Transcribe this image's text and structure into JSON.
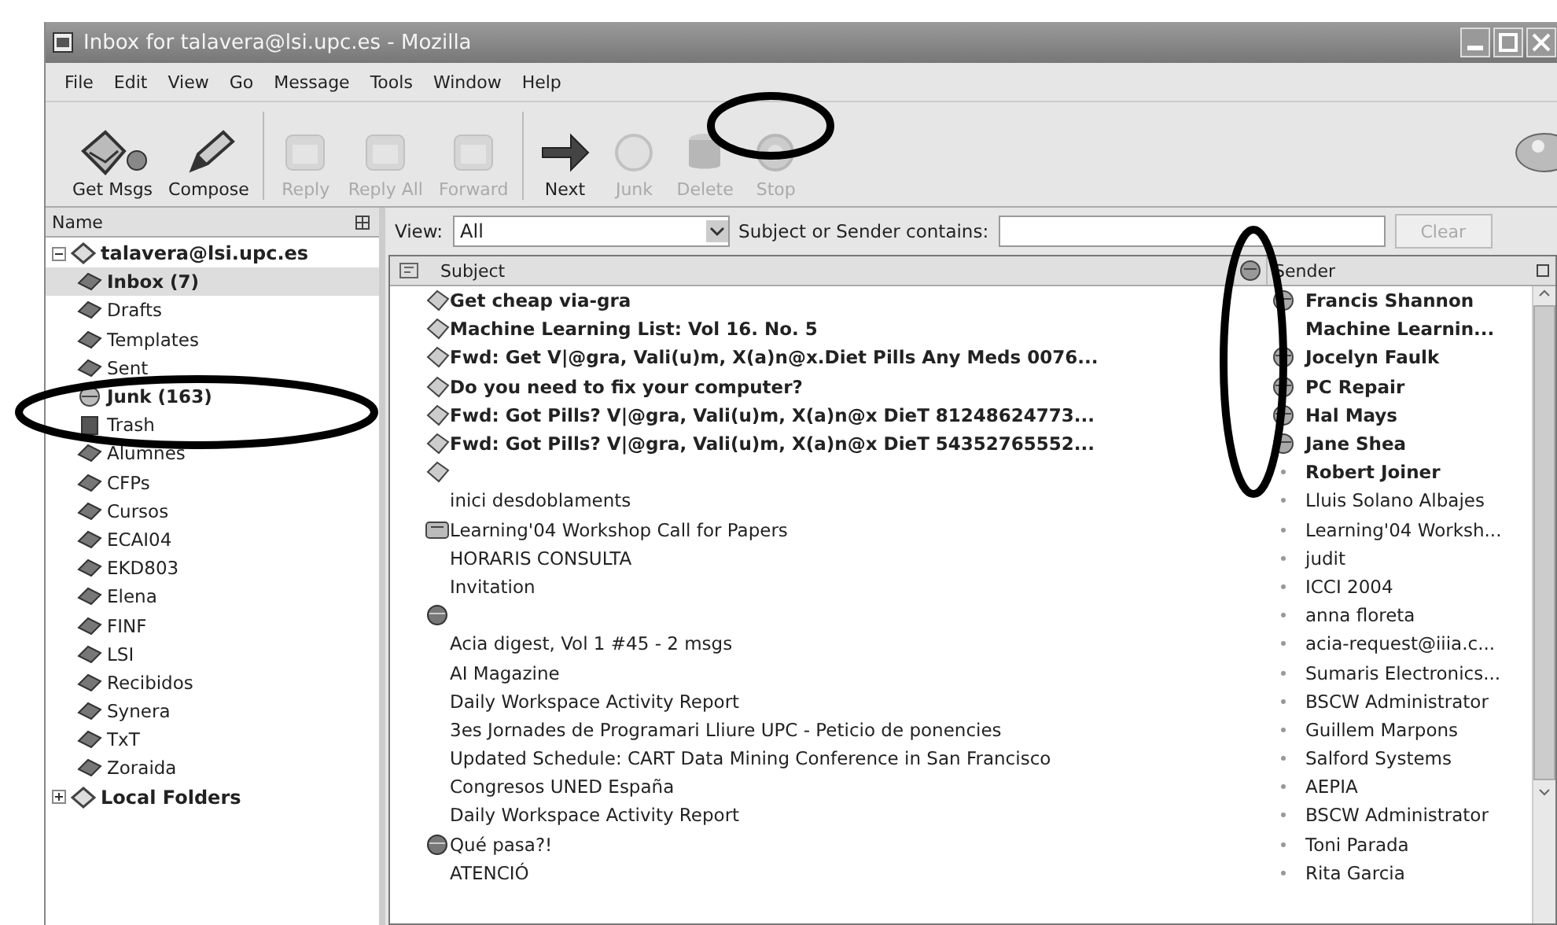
{
  "window": {
    "title": "Inbox for talavera@lsi.upc.es - Mozilla"
  },
  "menu": [
    "File",
    "Edit",
    "View",
    "Go",
    "Message",
    "Tools",
    "Window",
    "Help"
  ],
  "toolbar": [
    {
      "label": "Get Msgs",
      "kind": "getmsgs",
      "disabled": false
    },
    {
      "label": "Compose",
      "kind": "compose",
      "disabled": false
    },
    {
      "label": "Reply",
      "kind": "reply",
      "disabled": true
    },
    {
      "label": "Reply All",
      "kind": "reply",
      "disabled": true
    },
    {
      "label": "Forward",
      "kind": "reply",
      "disabled": true
    },
    {
      "label": "Next",
      "kind": "next",
      "disabled": false
    },
    {
      "label": "Junk",
      "kind": "junk",
      "disabled": true
    },
    {
      "label": "Delete",
      "kind": "delete",
      "disabled": true
    },
    {
      "label": "Stop",
      "kind": "stop",
      "disabled": true
    }
  ],
  "folder_pane": {
    "header": "Name",
    "accounts": [
      {
        "label": "talavera@lsi.upc.es",
        "expanded": true,
        "children": [
          {
            "label": "Inbox (7)",
            "unread": true,
            "selected": true,
            "kind": "folder"
          },
          {
            "label": "Drafts",
            "unread": false,
            "selected": false,
            "kind": "folder"
          },
          {
            "label": "Templates",
            "unread": false,
            "selected": false,
            "kind": "folder"
          },
          {
            "label": "Sent",
            "unread": false,
            "selected": false,
            "kind": "folder"
          },
          {
            "label": "Junk (163)",
            "unread": true,
            "selected": false,
            "kind": "junk"
          },
          {
            "label": "Trash",
            "unread": false,
            "selected": false,
            "kind": "trash"
          },
          {
            "label": "Alumnes",
            "unread": false,
            "selected": false,
            "kind": "folder"
          },
          {
            "label": "CFPs",
            "unread": false,
            "selected": false,
            "kind": "folder"
          },
          {
            "label": "Cursos",
            "unread": false,
            "selected": false,
            "kind": "folder"
          },
          {
            "label": "ECAI04",
            "unread": false,
            "selected": false,
            "kind": "folder"
          },
          {
            "label": "EKD803",
            "unread": false,
            "selected": false,
            "kind": "folder"
          },
          {
            "label": "Elena",
            "unread": false,
            "selected": false,
            "kind": "folder"
          },
          {
            "label": "FINF",
            "unread": false,
            "selected": false,
            "kind": "folder"
          },
          {
            "label": "LSI",
            "unread": false,
            "selected": false,
            "kind": "folder"
          },
          {
            "label": "Recibidos",
            "unread": false,
            "selected": false,
            "kind": "folder"
          },
          {
            "label": "Synera",
            "unread": false,
            "selected": false,
            "kind": "folder"
          },
          {
            "label": "TxT",
            "unread": false,
            "selected": false,
            "kind": "folder"
          },
          {
            "label": "Zoraida",
            "unread": false,
            "selected": false,
            "kind": "folder"
          }
        ]
      },
      {
        "label": "Local Folders",
        "expanded": false
      }
    ]
  },
  "filter": {
    "view_label": "View:",
    "view_value": "All",
    "search_label": "Subject or Sender contains:",
    "clear_button": "Clear",
    "clear_disabled": true
  },
  "message_list": {
    "columns": [
      "Subject",
      "Sender"
    ],
    "rows": [
      {
        "subject": "Get cheap via-gra",
        "sender": "Francis Shannon",
        "unread": true,
        "junk": true,
        "kind": "envelope"
      },
      {
        "subject": "Machine Learning List: Vol 16. No. 5",
        "sender": "Machine Learnin...",
        "unread": true,
        "junk": false,
        "kind": "envelope"
      },
      {
        "subject": "Fwd: Get V|@gra, Vali(u)m, X(a)n@x.Diet Pills Any Meds 0076...",
        "sender": "Jocelyn Faulk",
        "unread": true,
        "junk": true,
        "kind": "envelope"
      },
      {
        "subject": "Do you need to fix your computer?",
        "sender": "PC Repair",
        "unread": true,
        "junk": true,
        "kind": "envelope"
      },
      {
        "subject": "Fwd: Got Pills? V|@gra, Vali(u)m, X(a)n@x DieT 81248624773...",
        "sender": "Hal Mays",
        "unread": true,
        "junk": true,
        "kind": "envelope"
      },
      {
        "subject": "Fwd: Got Pills? V|@gra, Vali(u)m, X(a)n@x DieT 54352765552...",
        "sender": "Jane Shea",
        "unread": true,
        "junk": true,
        "kind": "envelope"
      },
      {
        "subject": "",
        "sender": "Robert Joiner",
        "unread": true,
        "junk": false,
        "kind": "envelope"
      },
      {
        "subject": "inici desdoblaments",
        "sender": "Lluis Solano Albajes",
        "unread": false,
        "junk": false,
        "kind": "plain"
      },
      {
        "subject": "Learning'04 Workshop Call for Papers",
        "sender": "Learning'04 Worksh...",
        "unread": false,
        "junk": false,
        "kind": "card"
      },
      {
        "subject": "HORARIS CONSULTA",
        "sender": "judit",
        "unread": false,
        "junk": false,
        "kind": "plain"
      },
      {
        "subject": "Invitation",
        "sender": "ICCI 2004",
        "unread": false,
        "junk": false,
        "kind": "plain"
      },
      {
        "subject": "",
        "sender": "anna floreta",
        "unread": false,
        "junk": false,
        "kind": "ball"
      },
      {
        "subject": "Acia digest, Vol 1 #45 - 2 msgs",
        "sender": "acia-request@iiia.c...",
        "unread": false,
        "junk": false,
        "kind": "plain"
      },
      {
        "subject": "AI Magazine",
        "sender": "Sumaris Electronics...",
        "unread": false,
        "junk": false,
        "kind": "plain"
      },
      {
        "subject": "Daily Workspace Activity Report",
        "sender": "BSCW Administrator",
        "unread": false,
        "junk": false,
        "kind": "plain"
      },
      {
        "subject": "3es Jornades de Programari Lliure UPC - Peticio de ponencies",
        "sender": "Guillem Marpons",
        "unread": false,
        "junk": false,
        "kind": "plain"
      },
      {
        "subject": "Updated Schedule: CART Data Mining Conference in San Francisco",
        "sender": "Salford Systems",
        "unread": false,
        "junk": false,
        "kind": "plain"
      },
      {
        "subject": "Congresos UNED España",
        "sender": "AEPIA",
        "unread": false,
        "junk": false,
        "kind": "plain"
      },
      {
        "subject": "Daily Workspace Activity Report",
        "sender": "BSCW Administrator",
        "unread": false,
        "junk": false,
        "kind": "plain"
      },
      {
        "subject": "Qué pasa?!",
        "sender": "Toni Parada",
        "unread": false,
        "junk": false,
        "kind": "ball"
      },
      {
        "subject": "ATENCIÓ",
        "sender": "Rita Garcia",
        "unread": false,
        "junk": false,
        "kind": "plain"
      }
    ]
  }
}
